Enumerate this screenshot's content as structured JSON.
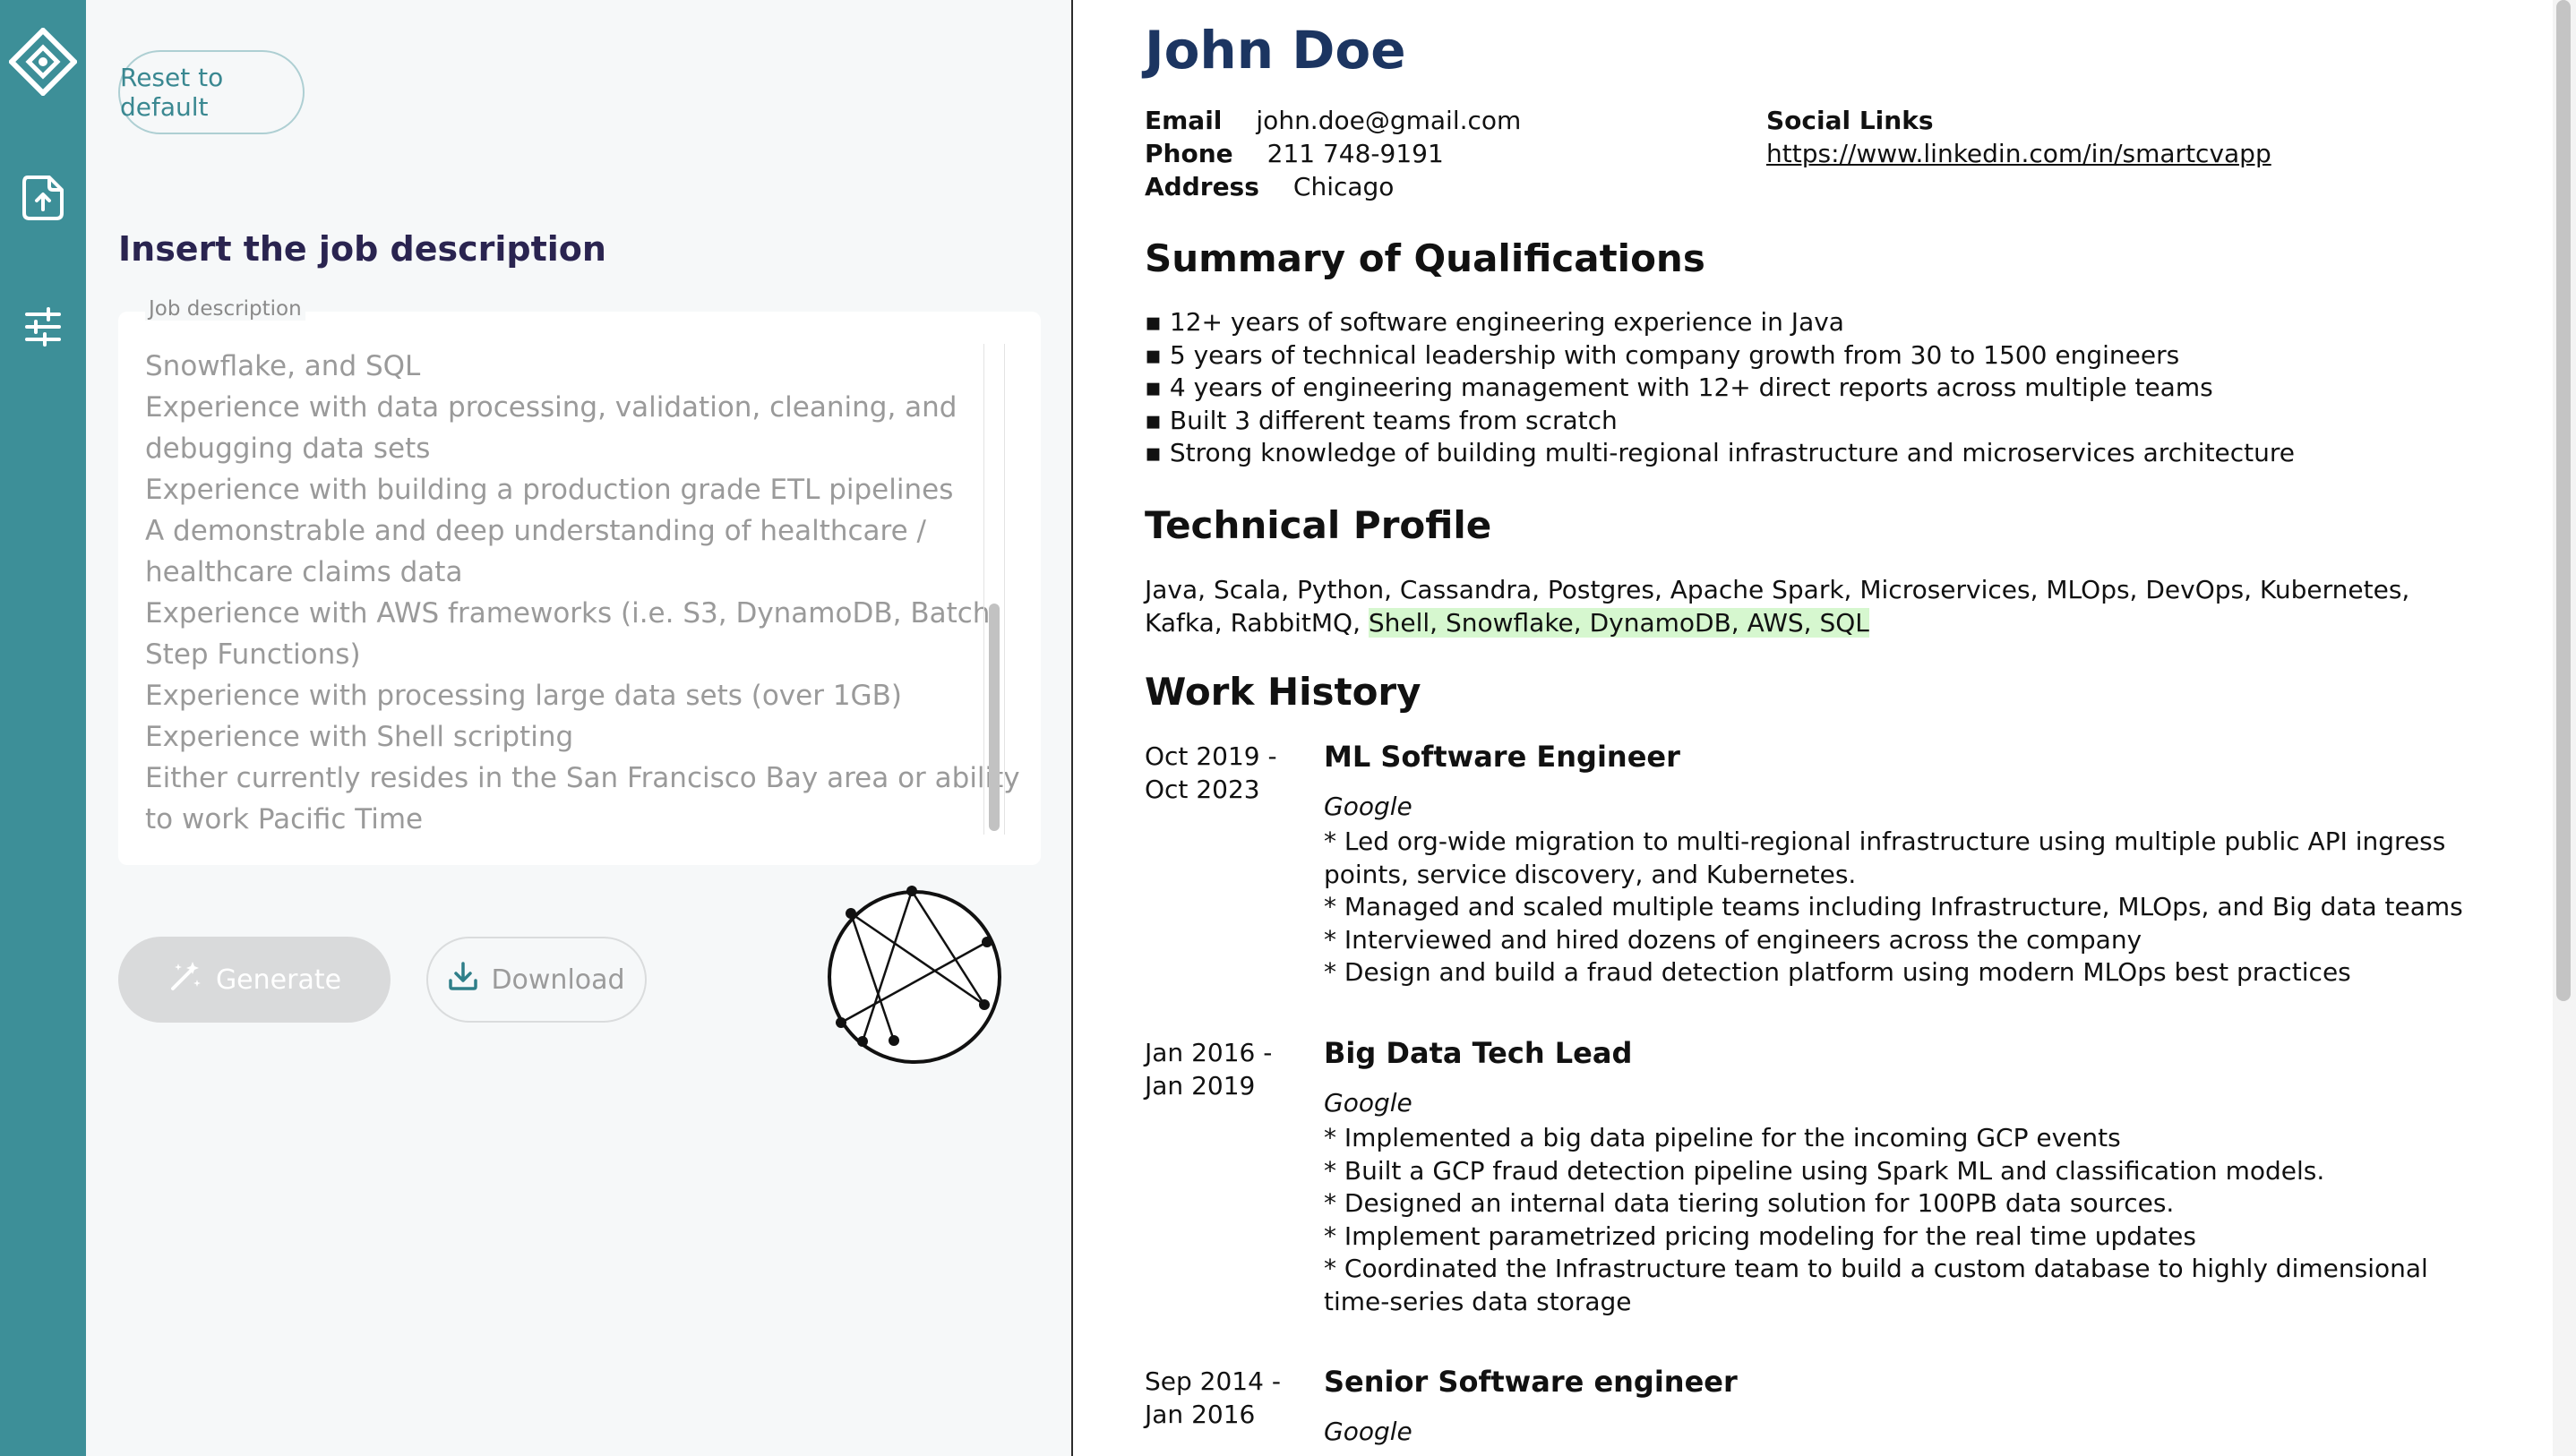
{
  "sidebar": {
    "icons": [
      "logo-diamond-icon",
      "upload-document-icon",
      "sliders-icon"
    ],
    "accent": "#3d8f98"
  },
  "left_panel": {
    "reset_label": "Reset to default",
    "section_title": "Insert the job description",
    "job_description_label": "Job description",
    "job_description_lines": [
      "Snowflake, and SQL",
      "Experience with data processing, validation, cleaning, and",
      "debugging data sets",
      "Experience with building a production grade ETL pipelines",
      "A demonstrable and deep understanding of healthcare /",
      "healthcare claims data",
      "Experience with AWS frameworks (i.e. S3, DynamoDB, Batch,",
      "Step Functions)",
      "Experience with processing large data sets (over 1GB)",
      "Experience with Shell scripting",
      "Either currently resides in the San Francisco Bay area or ability",
      "to work Pacific Time"
    ],
    "generate_label": "Generate",
    "download_label": "Download"
  },
  "resume": {
    "name": "John Doe",
    "contact": {
      "email_label": "Email",
      "email": "john.doe@gmail.com",
      "phone_label": "Phone",
      "phone": "211 748-9191",
      "address_label": "Address",
      "address": "Chicago"
    },
    "social": {
      "label": "Social Links",
      "link": "https://www.linkedin.com/in/smartcvapp"
    },
    "summary_title": "Summary of Qualifications",
    "summary": [
      "▪ 12+ years of software engineering experience in Java",
      "▪ 5 years of technical leadership with company growth from 30 to 1500 engineers",
      "▪ 4 years of engineering management with 12+ direct reports across multiple teams",
      "▪ Built 3 different teams from scratch",
      "▪ Strong knowledge of building multi-regional infrastructure and microservices architecture"
    ],
    "technical_title": "Technical Profile",
    "skills_plain": "Java, Scala, Python, Cassandra, Postgres, Apache Spark, Microservices, MLOps, DevOps, Kubernetes, Kafka, RabbitMQ, ",
    "skills_highlight": "Shell, Snowflake, DynamoDB, AWS, SQL",
    "highlight_color": "#d6f7cf",
    "work_title": "Work History",
    "jobs": [
      {
        "dates": [
          "Oct 2019 -",
          "Oct 2023"
        ],
        "title": "ML Software Engineer",
        "company": "Google",
        "lines": [
          "* Led org-wide migration to multi-regional infrastructure using multiple public API ingress points, service discovery, and Kubernetes.",
          "* Managed and scaled multiple teams including Infrastructure, MLOps, and Big data teams",
          "* Interviewed and hired dozens of engineers across the company",
          "* Design and build a fraud detection platform using modern MLOps best practices"
        ]
      },
      {
        "dates": [
          "Jan 2016 -",
          "Jan 2019"
        ],
        "title": "Big Data Tech Lead",
        "company": "Google",
        "lines": [
          "* Implemented a big data pipeline for the incoming GCP events",
          "* Built a GCP fraud detection pipeline using Spark ML and classification models.",
          "* Designed an internal data tiering solution for 100PB data sources.",
          "* Implement parametrized pricing modeling for the real time updates",
          "* Coordinated the Infrastructure team to build a custom database to highly dimensional time-series data storage"
        ]
      },
      {
        "dates": [
          "Sep 2014 -",
          "Jan 2016"
        ],
        "title": "Senior Software engineer",
        "company": "Google",
        "lines": []
      }
    ]
  }
}
